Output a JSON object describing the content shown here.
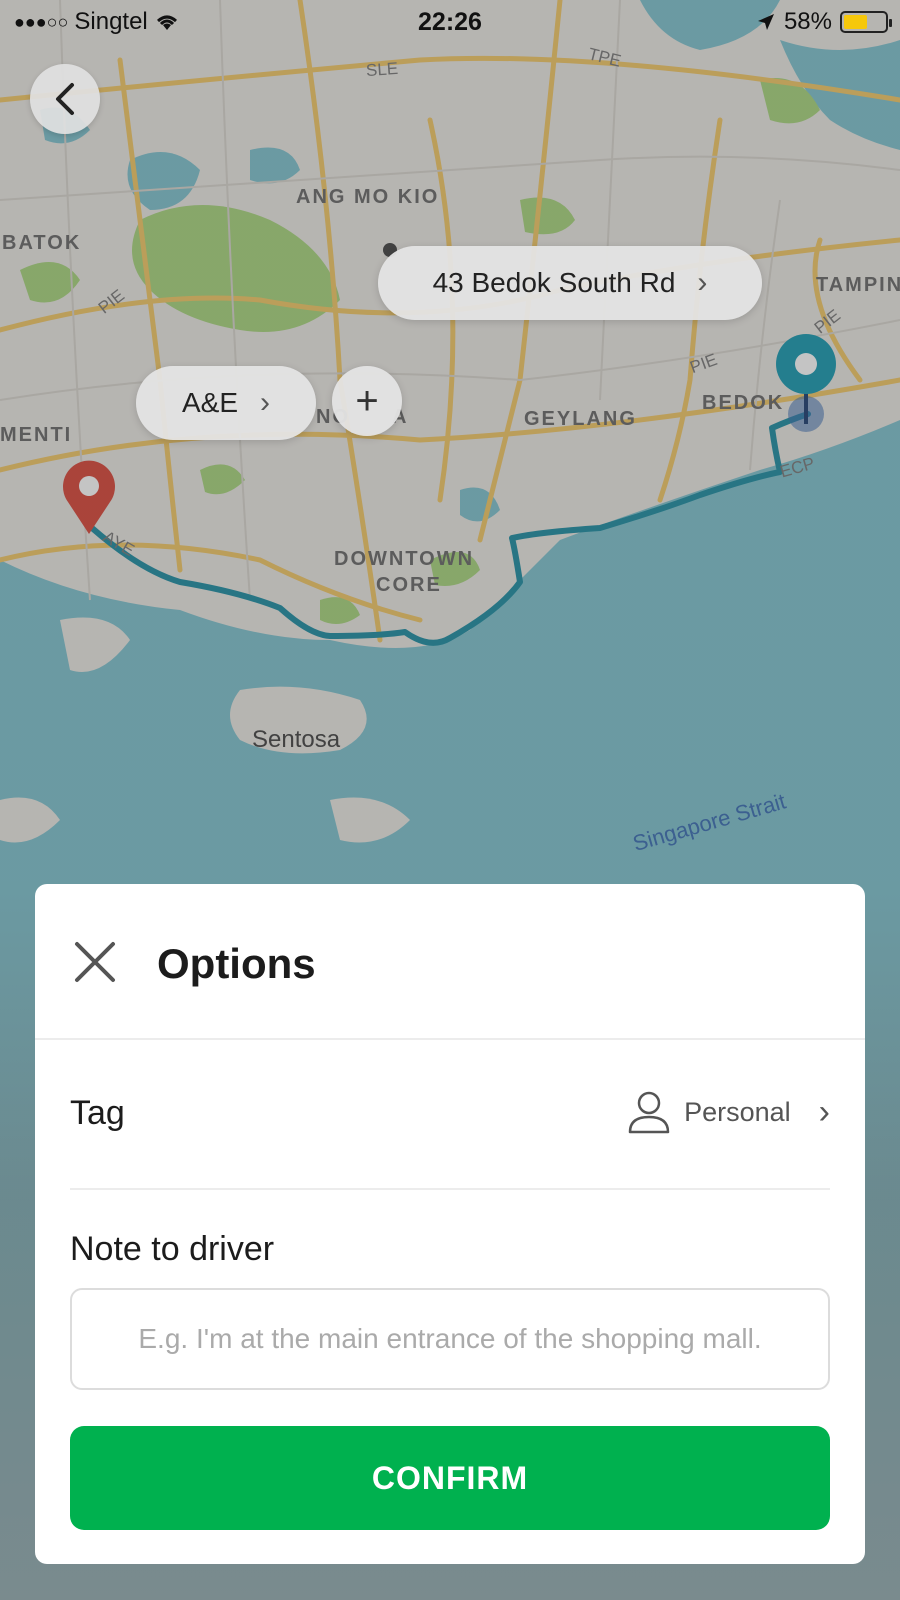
{
  "status_bar": {
    "signal": "●●●○○",
    "carrier": "Singtel",
    "time": "22:26",
    "battery_percent": "58%",
    "battery_level": 0.58,
    "battery_color": "#f6c80b"
  },
  "map": {
    "labels": {
      "ang_mo_kio": "ANG MO KIO",
      "batok": "BATOK",
      "tampin": "TAMPIN",
      "bedok": "BEDOK",
      "geylang": "GEYLANG",
      "menti": "MENTI",
      "downtown_core_1": "DOWNTOWN",
      "downtown_core_2": "CORE",
      "sentosa": "Sentosa",
      "singapore_strait": "Singapore Strait",
      "novena_partial_1": "NO",
      "novena_partial_2": "A"
    },
    "roads": {
      "sle": "SLE",
      "tpe": "TPE",
      "pie_west": "PIE",
      "pie_east": "PIE",
      "pie_far_east": "PIE",
      "ecp": "ECP",
      "aye": "AYE"
    },
    "colors": {
      "land": "#ebe9e4",
      "sea": "#7fc3cf",
      "park": "#a8d57e",
      "road": "#f2c867",
      "route": "#1f8ea3",
      "pickup_pin": "#d9473a",
      "destination_pin": "#1a9bb2"
    }
  },
  "controls": {
    "destination_pill": "43 Bedok South Rd",
    "stop_pill": "A&E",
    "add_stop": "+"
  },
  "options_sheet": {
    "title": "Options",
    "tag_label": "Tag",
    "tag_value": "Personal",
    "note_label": "Note to driver",
    "note_placeholder": "E.g. I'm at the main entrance of the shopping mall.",
    "note_value": "",
    "confirm_label": "CONFIRM",
    "confirm_color": "#00b14f"
  },
  "icons": {
    "back": "chevron-left-icon",
    "close": "close-icon",
    "person": "person-icon",
    "chevron": "chevron-right-icon",
    "wifi": "wifi-icon",
    "location_arrow": "location-arrow-icon"
  }
}
